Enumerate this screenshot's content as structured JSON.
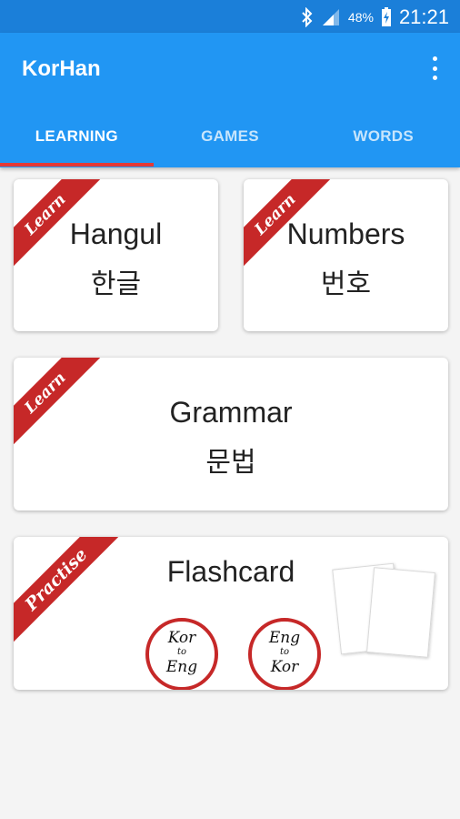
{
  "status_bar": {
    "icons": [
      "bluetooth-icon",
      "signal-icon",
      "battery-charging-icon"
    ],
    "battery_percent": "48%",
    "time": "21:21"
  },
  "app_bar": {
    "title": "KorHan",
    "menu_icon": "more-vert-icon"
  },
  "tabs": [
    {
      "label": "LEARNING",
      "active": true
    },
    {
      "label": "GAMES",
      "active": false
    },
    {
      "label": "WORDS",
      "active": false
    }
  ],
  "colors": {
    "primary": "#2196f3",
    "status_bar": "#1b7fd9",
    "accent": "#e53935",
    "ribbon": "#c62828"
  },
  "cards": {
    "hangul": {
      "ribbon": "Learn",
      "title": "Hangul",
      "subtitle": "한글"
    },
    "numbers": {
      "ribbon": "Learn",
      "title": "Numbers",
      "subtitle": "번호"
    },
    "grammar": {
      "ribbon": "Learn",
      "title": "Grammar",
      "subtitle": "문법"
    },
    "flashcard": {
      "ribbon": "Practise",
      "title": "Flashcard",
      "kor_to_eng": {
        "top": "Kor",
        "middle": "to",
        "bottom": "Eng"
      },
      "eng_to_kor": {
        "top": "Eng",
        "middle": "to",
        "bottom": "Kor"
      }
    }
  }
}
